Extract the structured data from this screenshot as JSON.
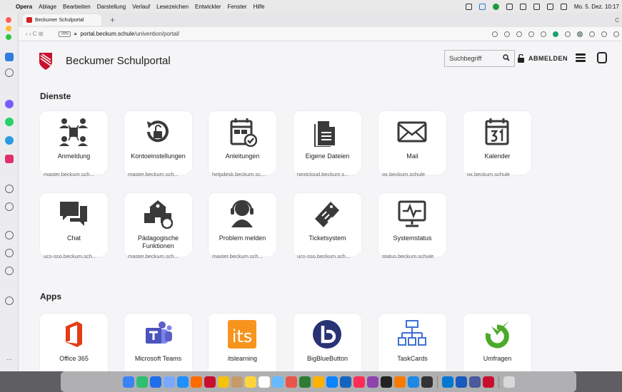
{
  "menubar": {
    "app": "Opera",
    "items": [
      "Ablage",
      "Bearbeiten",
      "Darstellung",
      "Verlauf",
      "Lesezeichen",
      "Entwickler",
      "Fenster",
      "Hilfe"
    ],
    "clock": "Mo. 5. Dez. 10:17"
  },
  "browser": {
    "tab_title": "Beckumer Schulportal",
    "new_tab": "+",
    "vpn": "VPN",
    "url_domain": "portal.beckum.schule",
    "url_path": "/univention/portal/"
  },
  "portal": {
    "title": "Beckumer Schulportal",
    "search_placeholder": "Suchbegriff",
    "logout": "ABMELDEN",
    "sections": [
      {
        "title": "Dienste",
        "tiles": [
          {
            "name": "Anmeldung",
            "domain": "master.beckum.sch...",
            "icon": "users-network-icon"
          },
          {
            "name": "Kontoeinstellungen",
            "domain": "master.beckum.sch...",
            "icon": "unlock-reset-icon"
          },
          {
            "name": "Anleitungen",
            "domain": "helpdesk.beckum.sc...",
            "icon": "calendar-check-icon"
          },
          {
            "name": "Eigene Dateien",
            "domain": "nextcloud.beckum.s...",
            "icon": "files-icon"
          },
          {
            "name": "Mail",
            "domain": "ox.beckum.schule",
            "icon": "mail-icon"
          },
          {
            "name": "Kalender",
            "domain": "ox.beckum.schule",
            "icon": "calendar-icon"
          },
          {
            "name": "Chat",
            "domain": "ucs-sso.beckum.sch...",
            "icon": "chat-icon"
          },
          {
            "name": "Pädagogische Funktionen",
            "domain": "master.beckum.sch...",
            "icon": "school-icon"
          },
          {
            "name": "Problem melden",
            "domain": "master.beckum.sch...",
            "icon": "support-headset-icon"
          },
          {
            "name": "Ticketsystem",
            "domain": "ucs-sso.beckum.sch...",
            "icon": "ticket-icon"
          },
          {
            "name": "Systemstatus",
            "domain": "status.beckum.schule",
            "icon": "monitor-pulse-icon"
          }
        ]
      },
      {
        "title": "Apps",
        "tiles": [
          {
            "name": "Office 365",
            "icon": "office-icon"
          },
          {
            "name": "Microsoft Teams",
            "icon": "teams-icon"
          },
          {
            "name": "itslearning",
            "icon": "itslearning-icon"
          },
          {
            "name": "BigBlueButton",
            "icon": "bigbluebutton-icon"
          },
          {
            "name": "TaskCards",
            "icon": "taskcards-icon"
          },
          {
            "name": "Umfragen",
            "icon": "survey-icon"
          }
        ]
      }
    ]
  },
  "colors": {
    "accent": "#c8102e",
    "tile_bg": "#ffffff",
    "page_bg": "#f5f5f7"
  }
}
